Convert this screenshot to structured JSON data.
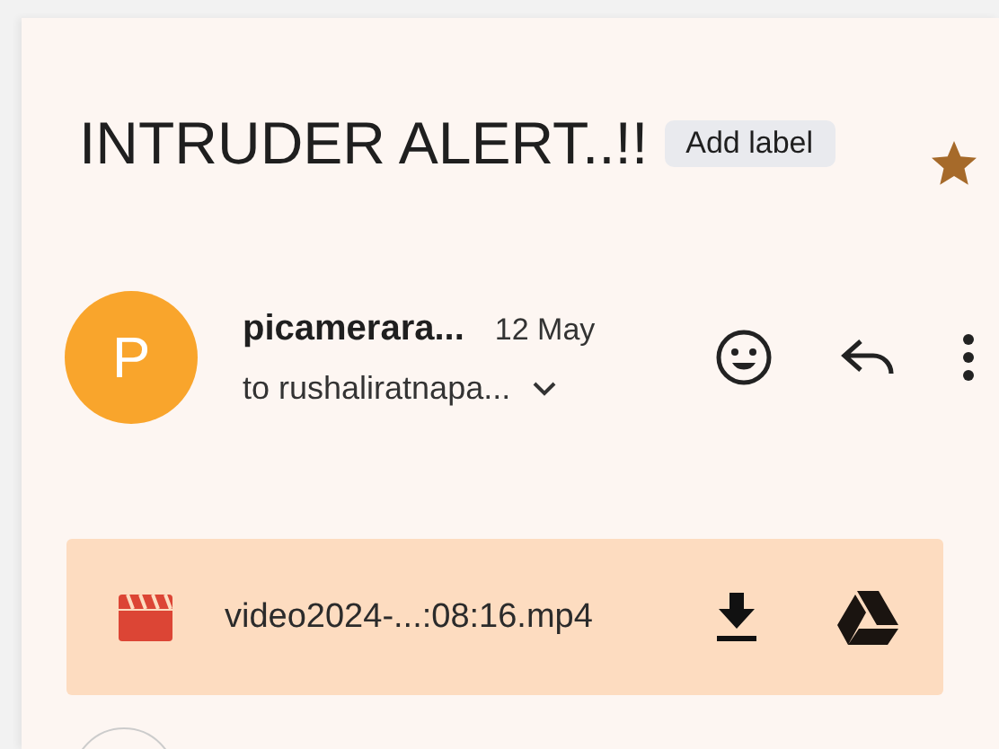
{
  "subject": {
    "title": "INTRUDER ALERT..!!",
    "label_button": "Add label",
    "starred": true
  },
  "message": {
    "avatar_letter": "P",
    "sender": "picamerara...",
    "date": "12 May",
    "recipient": "to rushaliratnapa..."
  },
  "attachments": [
    {
      "kind": "video",
      "name": "video2024-...:08:16.mp4"
    }
  ]
}
